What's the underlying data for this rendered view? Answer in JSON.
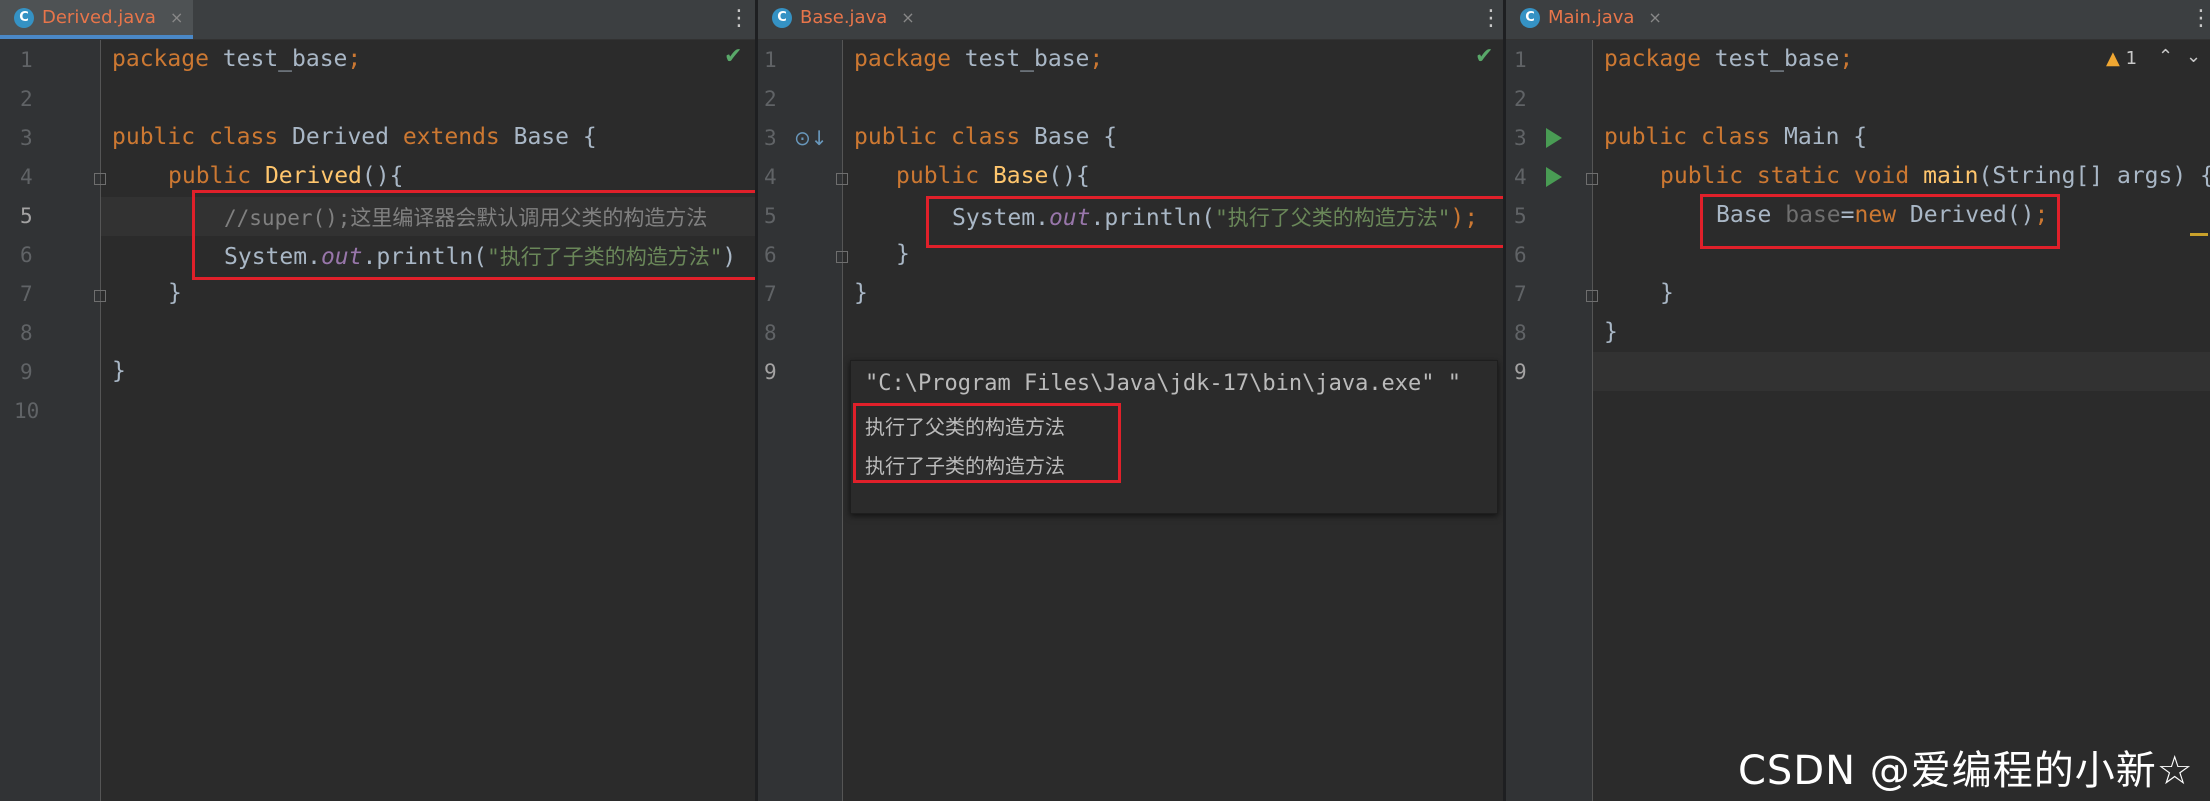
{
  "panes": [
    {
      "tab": {
        "icon": "C",
        "label": "Derived.java",
        "close": "×"
      },
      "lines": [
        "1",
        "2",
        "3",
        "4",
        "5",
        "6",
        "7",
        "8",
        "9",
        "10"
      ],
      "code": {
        "l1_kw": "package",
        "l1_rest": " test_base",
        "l1_semi": ";",
        "l3_kw1": "public",
        "l3_kw2": "class",
        "l3_name": " Derived ",
        "l3_kw3": "extends",
        "l3_rest": " Base {",
        "l4_kw": "public",
        "l4_fn": "Derived",
        "l4_rest": "(){",
        "l5_comment": "//super();这里编译器会默认调用父类的构造方法",
        "l6_pre": "System.",
        "l6_it": "out",
        "l6_mid": ".println(",
        "l6_str": "\"执行了子类的构造方法\"",
        "l6_end": ")",
        "l7": "}",
        "l9": "}"
      }
    },
    {
      "tab": {
        "icon": "C",
        "label": "Base.java",
        "close": "×"
      },
      "lines": [
        "1",
        "2",
        "3",
        "4",
        "5",
        "6",
        "7",
        "8",
        "9"
      ],
      "code": {
        "l1_kw": "package",
        "l1_rest": " test_base",
        "l1_semi": ";",
        "l3_kw1": "public",
        "l3_kw2": "class",
        "l3_rest": " Base {",
        "l4_kw": "public",
        "l4_fn": "Base",
        "l4_rest": "(){",
        "l5_pre": "System.",
        "l5_it": "out",
        "l5_mid": ".println(",
        "l5_str": "\"执行了父类的构造方法\"",
        "l5_end": ");",
        "l6": "}",
        "l7": "}"
      },
      "console": {
        "cmd": "\"C:\\Program Files\\Java\\jdk-17\\bin\\java.exe\" \"",
        "out1": "执行了父类的构造方法",
        "out2": "执行了子类的构造方法"
      }
    },
    {
      "tab": {
        "icon": "C",
        "label": "Main.java",
        "close": "×"
      },
      "lines": [
        "1",
        "2",
        "3",
        "4",
        "5",
        "6",
        "7",
        "8",
        "9"
      ],
      "warnings": "1",
      "code": {
        "l1_kw": "package",
        "l1_rest": " test_base",
        "l1_semi": ";",
        "l3_kw1": "public",
        "l3_kw2": "class",
        "l3_rest": " Main {",
        "l4_kw": "public static void",
        "l4_fn": "main",
        "l4_rest": "(String[] args) {",
        "l5_type": "Base ",
        "l5_var": "base",
        "l5_eq": "=",
        "l5_new": "new",
        "l5_rest": " Derived()",
        "l5_semi": ";",
        "l7": "}",
        "l8": "}"
      }
    }
  ],
  "watermark": "CSDN @爱编程的小新☆"
}
